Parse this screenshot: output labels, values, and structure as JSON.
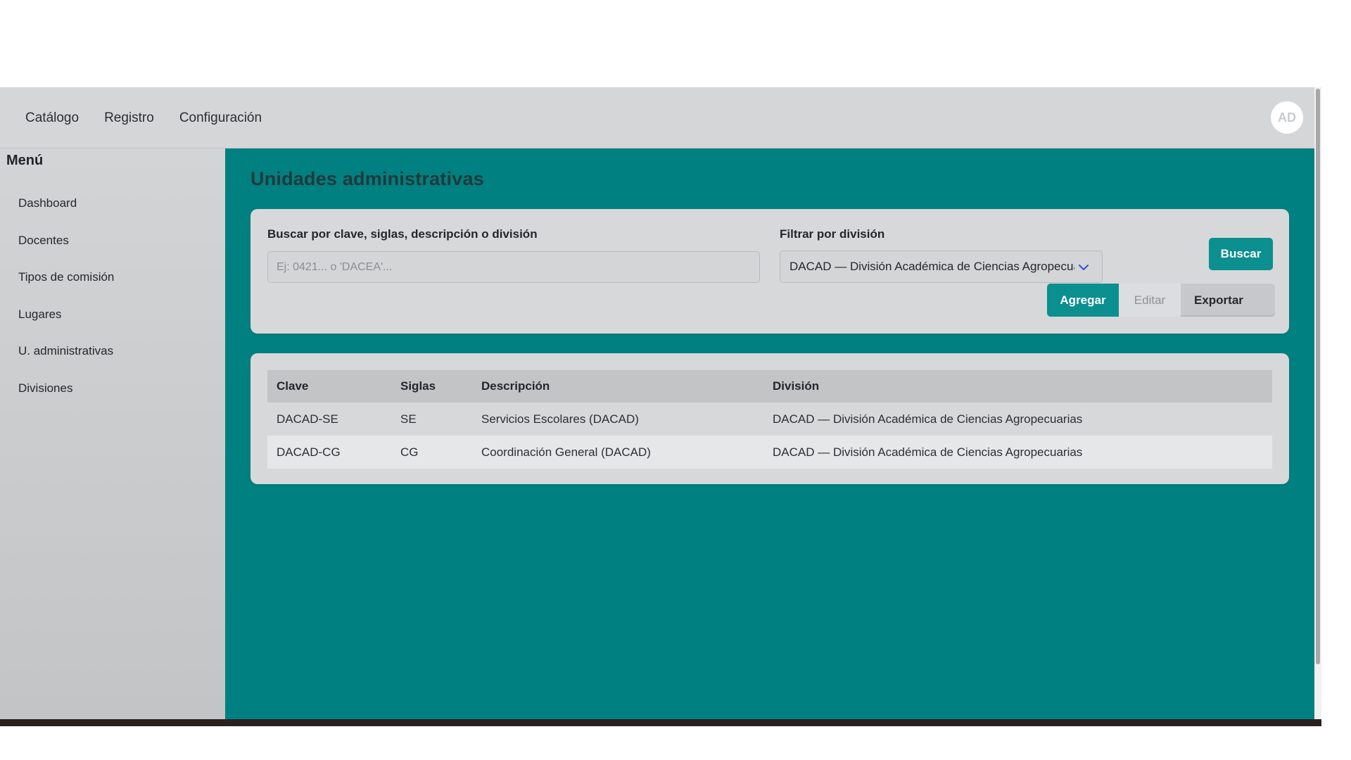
{
  "nav": {
    "items": [
      {
        "label": "Catálogo"
      },
      {
        "label": "Registro"
      },
      {
        "label": "Configuración"
      }
    ],
    "avatar_initials": "AD"
  },
  "sidebar": {
    "title": "Menú",
    "items": [
      {
        "label": "Dashboard"
      },
      {
        "label": "Docentes"
      },
      {
        "label": "Tipos de comisión"
      },
      {
        "label": "Lugares"
      },
      {
        "label": "U. administrativas"
      },
      {
        "label": "Divisiones"
      }
    ]
  },
  "page": {
    "title": "Unidades administrativas"
  },
  "filters": {
    "search_label": "Buscar por clave, siglas, descripción o división",
    "search_placeholder": "Ej: 0421... o 'DACEA'...",
    "search_value": "",
    "division_label": "Filtrar por división",
    "division_selected": "DACAD — División Académica de Ciencias Agropecuarias",
    "buscar_label": "Buscar",
    "agregar_label": "Agregar",
    "editar_label": "Editar",
    "exportar_label": "Exportar"
  },
  "table": {
    "headers": {
      "clave": "Clave",
      "siglas": "Siglas",
      "descripcion": "Descripción",
      "division": "División"
    },
    "rows": [
      {
        "clave": "DACAD-SE",
        "siglas": "SE",
        "descripcion": "Servicios Escolares (DACAD)",
        "division": "DACAD — División Académica de Ciencias Agropecuarias"
      },
      {
        "clave": "DACAD-CG",
        "siglas": "CG",
        "descripcion": "Coordinación General (DACAD)",
        "division": "DACAD — División Académica de Ciencias Agropecuarias"
      }
    ]
  },
  "colors": {
    "accent": "#008080",
    "button_primary": "#0b8f8f",
    "topbar": "#d5d6d8",
    "sidebar": "#c8cacc"
  },
  "icons": {
    "select": "chevron-down-icon"
  }
}
